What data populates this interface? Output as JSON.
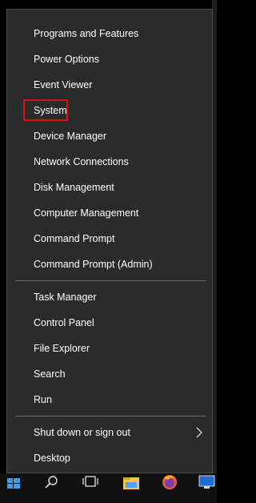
{
  "menu": {
    "items": [
      {
        "label": "Programs and Features"
      },
      {
        "label": "Power Options"
      },
      {
        "label": "Event Viewer"
      },
      {
        "label": "System"
      },
      {
        "label": "Device Manager"
      },
      {
        "label": "Network Connections"
      },
      {
        "label": "Disk Management"
      },
      {
        "label": "Computer Management"
      },
      {
        "label": "Command Prompt"
      },
      {
        "label": "Command Prompt (Admin)"
      },
      {
        "label": "Task Manager"
      },
      {
        "label": "Control Panel"
      },
      {
        "label": "File Explorer"
      },
      {
        "label": "Search"
      },
      {
        "label": "Run"
      },
      {
        "label": "Shut down or sign out"
      },
      {
        "label": "Desktop"
      }
    ],
    "highlight_color": "#e01010"
  },
  "taskbar": {
    "icons": [
      "windows-start-icon",
      "search-icon",
      "task-view-icon",
      "file-explorer-icon",
      "firefox-icon",
      "network-icon"
    ]
  }
}
